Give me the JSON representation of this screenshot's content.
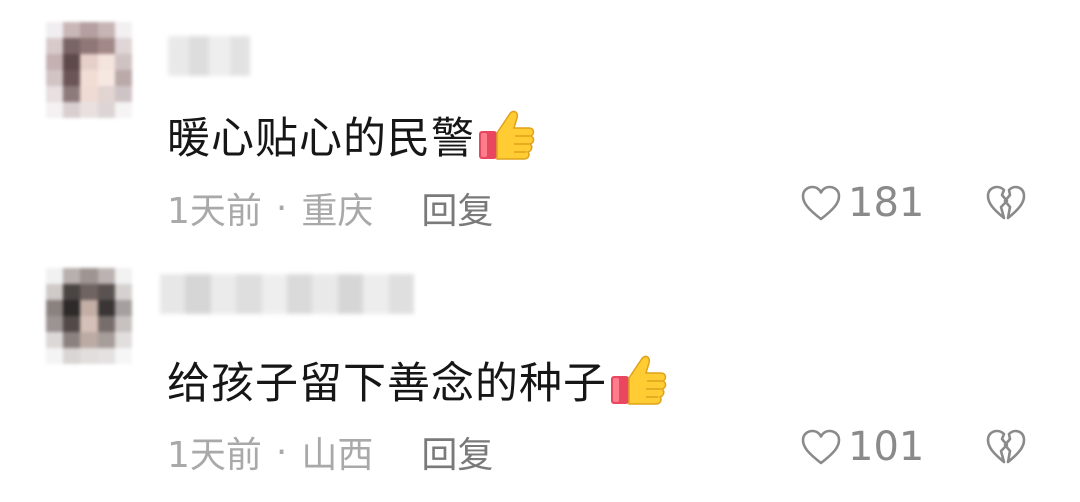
{
  "comments": [
    {
      "text": "暖心贴心的民警",
      "time": "1天前",
      "separator": "·",
      "location": "重庆",
      "reply_label": "回复",
      "like_count": "181"
    },
    {
      "text": "给孩子留下善念的种子",
      "time": "1天前",
      "separator": "·",
      "location": "山西",
      "reply_label": "回复",
      "like_count": "101"
    }
  ],
  "icons": {
    "like": "heart-outline-icon",
    "dislike": "broken-heart-icon",
    "emoji": "thumbs-up-emoji-icon"
  },
  "colors": {
    "comment_text": "#161616",
    "meta_text": "#a9a9a9",
    "icon_gray": "#8a8a8a"
  }
}
